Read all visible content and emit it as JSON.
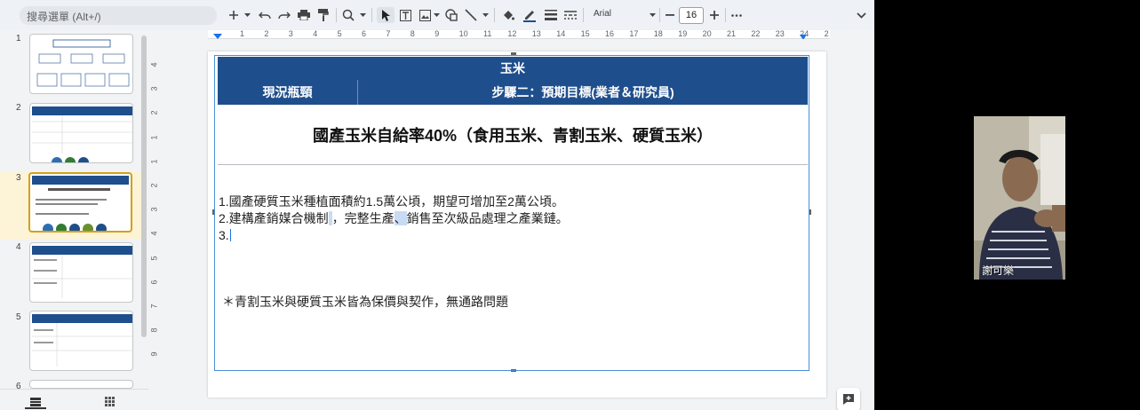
{
  "toolbar": {
    "search_placeholder": "搜尋選單 (Alt+/)",
    "font_name": "Arial",
    "font_size": "16",
    "icons": [
      "plus-icon",
      "undo-icon",
      "redo-icon",
      "print-icon",
      "paint-format-icon",
      "zoom-icon",
      "select-icon",
      "textbox-icon",
      "image-icon",
      "shape-icon",
      "line-icon",
      "fill-color-icon",
      "border-color-icon",
      "border-weight-icon",
      "border-dash-icon",
      "minus-icon",
      "more-icon",
      "collapse-icon"
    ]
  },
  "filmstrip": {
    "slides": [
      {
        "number": "1"
      },
      {
        "number": "2"
      },
      {
        "number": "3",
        "active": true
      },
      {
        "number": "4"
      },
      {
        "number": "5"
      },
      {
        "number": "6"
      }
    ]
  },
  "rulers": {
    "top": [
      "1",
      "2",
      "3",
      "4",
      "5",
      "6",
      "7",
      "8",
      "9",
      "10",
      "11",
      "12",
      "13",
      "14",
      "15",
      "16",
      "17",
      "18",
      "19",
      "20",
      "21",
      "22",
      "23",
      "24",
      "2"
    ],
    "left": [
      "4",
      "3",
      "2",
      "1",
      "1",
      "2",
      "3",
      "4",
      "5",
      "6",
      "7",
      "8",
      "9"
    ]
  },
  "slide": {
    "table_title": "玉米",
    "col1_header": "現況瓶頸",
    "col2_header": "步驟二：預期目標(業者＆研究員)",
    "goal": "國產玉米自給率40%（食用玉米、青割玉米、硬質玉米）",
    "line1": "1.國產硬質玉米種植面積約1.5萬公頃，期望可增加至2萬公頃。",
    "line2a": "2.建構產銷媒合機制",
    "line2b": "，完整生產",
    "line2c": "、",
    "line2d": "銷售至次級品處理之產業鏈。",
    "line3": "3.",
    "note": "＊青割玉米與硬質玉米皆為保價與契作，無通路問題"
  },
  "webcam": {
    "name": "謝可樂"
  },
  "colors": {
    "header_bg": "#1f4e8c",
    "accent": "#d4a017",
    "selection": "#4a8fd6"
  }
}
